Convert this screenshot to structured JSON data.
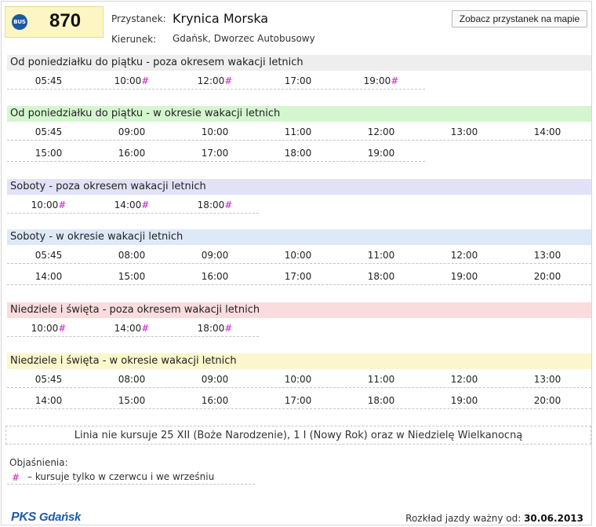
{
  "header": {
    "bus_badge": "BUS",
    "line_number": "870",
    "stop_label": "Przystanek:",
    "stop_name": "Krynica Morska",
    "direction_label": "Kierunek:",
    "direction_name": "Gdańsk, Dworzec Autobusowy",
    "map_button": "Zobacz przystanek na mapie"
  },
  "colors": {
    "weekday_off_season": "#eeeeee",
    "weekday_season": "#d5f5d0",
    "saturday_off_season": "#e2e2f7",
    "saturday_season": "#dde9f7",
    "sunday_off_season": "#fadcdc",
    "sunday_season": "#fbf6cc",
    "mark": "#c21ec2"
  },
  "sections": [
    {
      "title": "Od poniedziałku do piątku - poza okresem wakacji letnich",
      "rows": [
        [
          {
            "t": "05:45",
            "m": ""
          },
          {
            "t": "10:00",
            "m": "#"
          },
          {
            "t": "12:00",
            "m": "#"
          },
          {
            "t": "17:00",
            "m": ""
          },
          {
            "t": "19:00",
            "m": "#"
          }
        ]
      ]
    },
    {
      "title": "Od poniedziałku do piątku - w okresie wakacji letnich",
      "rows": [
        [
          {
            "t": "05:45",
            "m": ""
          },
          {
            "t": "09:00",
            "m": ""
          },
          {
            "t": "10:00",
            "m": ""
          },
          {
            "t": "11:00",
            "m": ""
          },
          {
            "t": "12:00",
            "m": ""
          },
          {
            "t": "13:00",
            "m": ""
          },
          {
            "t": "14:00",
            "m": ""
          }
        ],
        [
          {
            "t": "15:00",
            "m": ""
          },
          {
            "t": "16:00",
            "m": ""
          },
          {
            "t": "17:00",
            "m": ""
          },
          {
            "t": "18:00",
            "m": ""
          },
          {
            "t": "19:00",
            "m": ""
          }
        ]
      ]
    },
    {
      "title": "Soboty - poza okresem wakacji letnich",
      "rows": [
        [
          {
            "t": "10:00",
            "m": "#"
          },
          {
            "t": "14:00",
            "m": "#"
          },
          {
            "t": "18:00",
            "m": "#"
          }
        ]
      ]
    },
    {
      "title": "Soboty - w okresie wakacji letnich",
      "rows": [
        [
          {
            "t": "05:45",
            "m": ""
          },
          {
            "t": "08:00",
            "m": ""
          },
          {
            "t": "09:00",
            "m": ""
          },
          {
            "t": "10:00",
            "m": ""
          },
          {
            "t": "11:00",
            "m": ""
          },
          {
            "t": "12:00",
            "m": ""
          },
          {
            "t": "13:00",
            "m": ""
          }
        ],
        [
          {
            "t": "14:00",
            "m": ""
          },
          {
            "t": "15:00",
            "m": ""
          },
          {
            "t": "16:00",
            "m": ""
          },
          {
            "t": "17:00",
            "m": ""
          },
          {
            "t": "18:00",
            "m": ""
          },
          {
            "t": "19:00",
            "m": ""
          },
          {
            "t": "20:00",
            "m": ""
          }
        ]
      ]
    },
    {
      "title": "Niedziele i święta - poza okresem wakacji letnich",
      "rows": [
        [
          {
            "t": "10:00",
            "m": "#"
          },
          {
            "t": "14:00",
            "m": "#"
          },
          {
            "t": "18:00",
            "m": "#"
          }
        ]
      ]
    },
    {
      "title": "Niedziele i święta - w okresie wakacji letnich",
      "rows": [
        [
          {
            "t": "05:45",
            "m": ""
          },
          {
            "t": "08:00",
            "m": ""
          },
          {
            "t": "09:00",
            "m": ""
          },
          {
            "t": "10:00",
            "m": ""
          },
          {
            "t": "11:00",
            "m": ""
          },
          {
            "t": "12:00",
            "m": ""
          },
          {
            "t": "13:00",
            "m": ""
          }
        ],
        [
          {
            "t": "14:00",
            "m": ""
          },
          {
            "t": "15:00",
            "m": ""
          },
          {
            "t": "16:00",
            "m": ""
          },
          {
            "t": "17:00",
            "m": ""
          },
          {
            "t": "18:00",
            "m": ""
          },
          {
            "t": "19:00",
            "m": ""
          },
          {
            "t": "20:00",
            "m": ""
          }
        ]
      ]
    }
  ],
  "footer": {
    "note": "Linia nie kursuje 25 XII (Boże Narodzenie), 1 I (Nowy Rok) oraz w Niedzielę Wielkanocną",
    "legend_title": "Objaśnienia:",
    "legend_symbol": "#",
    "legend_text": "– kursuje tylko w czerwcu i we wrześniu",
    "logo_pks": "PKS",
    "logo_city": "Gdańsk",
    "valid_label": "Rozkład jazdy ważny od:",
    "valid_date": "30.06.2013"
  }
}
